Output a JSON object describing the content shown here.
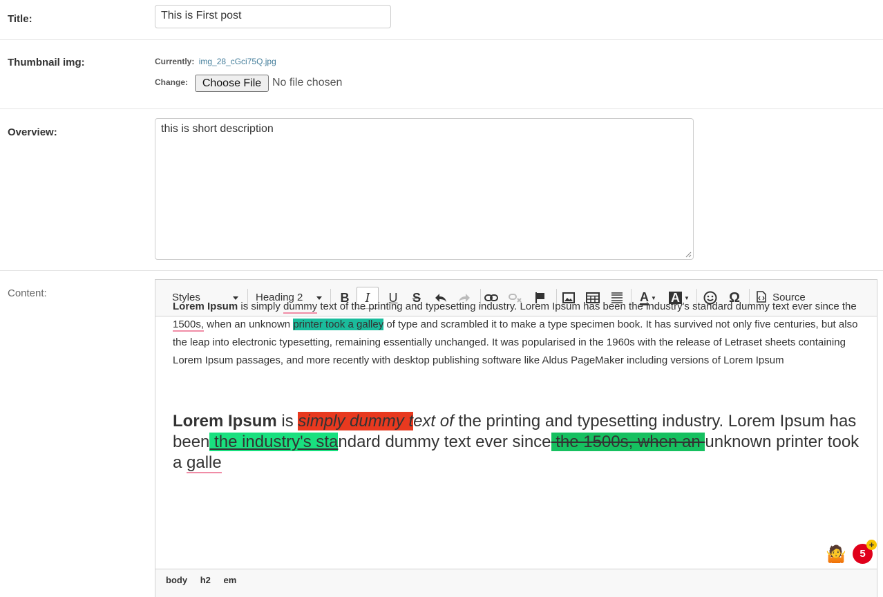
{
  "form": {
    "title_label": "Title:",
    "title_value": "This is First post",
    "thumb_label": "Thumbnail img:",
    "currently_label": "Currently:",
    "currently_file": "img_28_cGci75Q.jpg",
    "change_label": "Change:",
    "choose_file": "Choose File",
    "no_file": "No file chosen",
    "overview_label": "Overview:",
    "overview_value": "this is short description",
    "content_label": "Content:"
  },
  "toolbar": {
    "styles": "Styles",
    "format": "Heading 2",
    "source": "Source",
    "icons": [
      "bold-icon",
      "italic-icon",
      "underline-icon",
      "strike-icon",
      "undo-icon",
      "redo-icon",
      "link-icon",
      "unlink-icon",
      "anchor-icon",
      "image-icon",
      "table-icon",
      "hr-icon",
      "text-color-icon",
      "bg-color-icon",
      "smiley-icon",
      "special-char-icon",
      "source-icon"
    ]
  },
  "editor": {
    "p_bold": "Lorem Ipsum",
    "p_a": " is simply ",
    "p_spell1": "dummy",
    "p_b": " text of the printing and typesetting industry. Lorem Ipsum has been the industry's standard dummy text ever since the ",
    "p_spell2": "1500s,",
    "p_c": " when an unknown ",
    "p_hl": "printer took a galley",
    "p_d": " of type and scrambled it to make a type specimen book. It has survived not only five centuries, but also the leap into electronic typesetting, remaining essentially unchanged. It was popularised in the 1960s with the release of Letraset sheets containing Lorem Ipsum passages, and more recently with desktop publishing software like Aldus PageMaker including versions of Lorem Ipsum",
    "h_bold": "Lorem Ipsum",
    "h_a": " is ",
    "h_red": "simply dummy t",
    "h_b": "ext of",
    "h_c": " the printing and typesetting industry. Lorem Ipsum has been",
    "h_green": " the industry's sta",
    "h_d": "ndard dummy text ever since",
    "h_green2": " the 1500s, when an ",
    "h_e": "unknown printer took a ",
    "h_spell": "galle"
  },
  "pathbar": [
    "body",
    "h2",
    "em"
  ],
  "badge": {
    "count": "5",
    "plus": "+",
    "emoji": "🤷"
  }
}
